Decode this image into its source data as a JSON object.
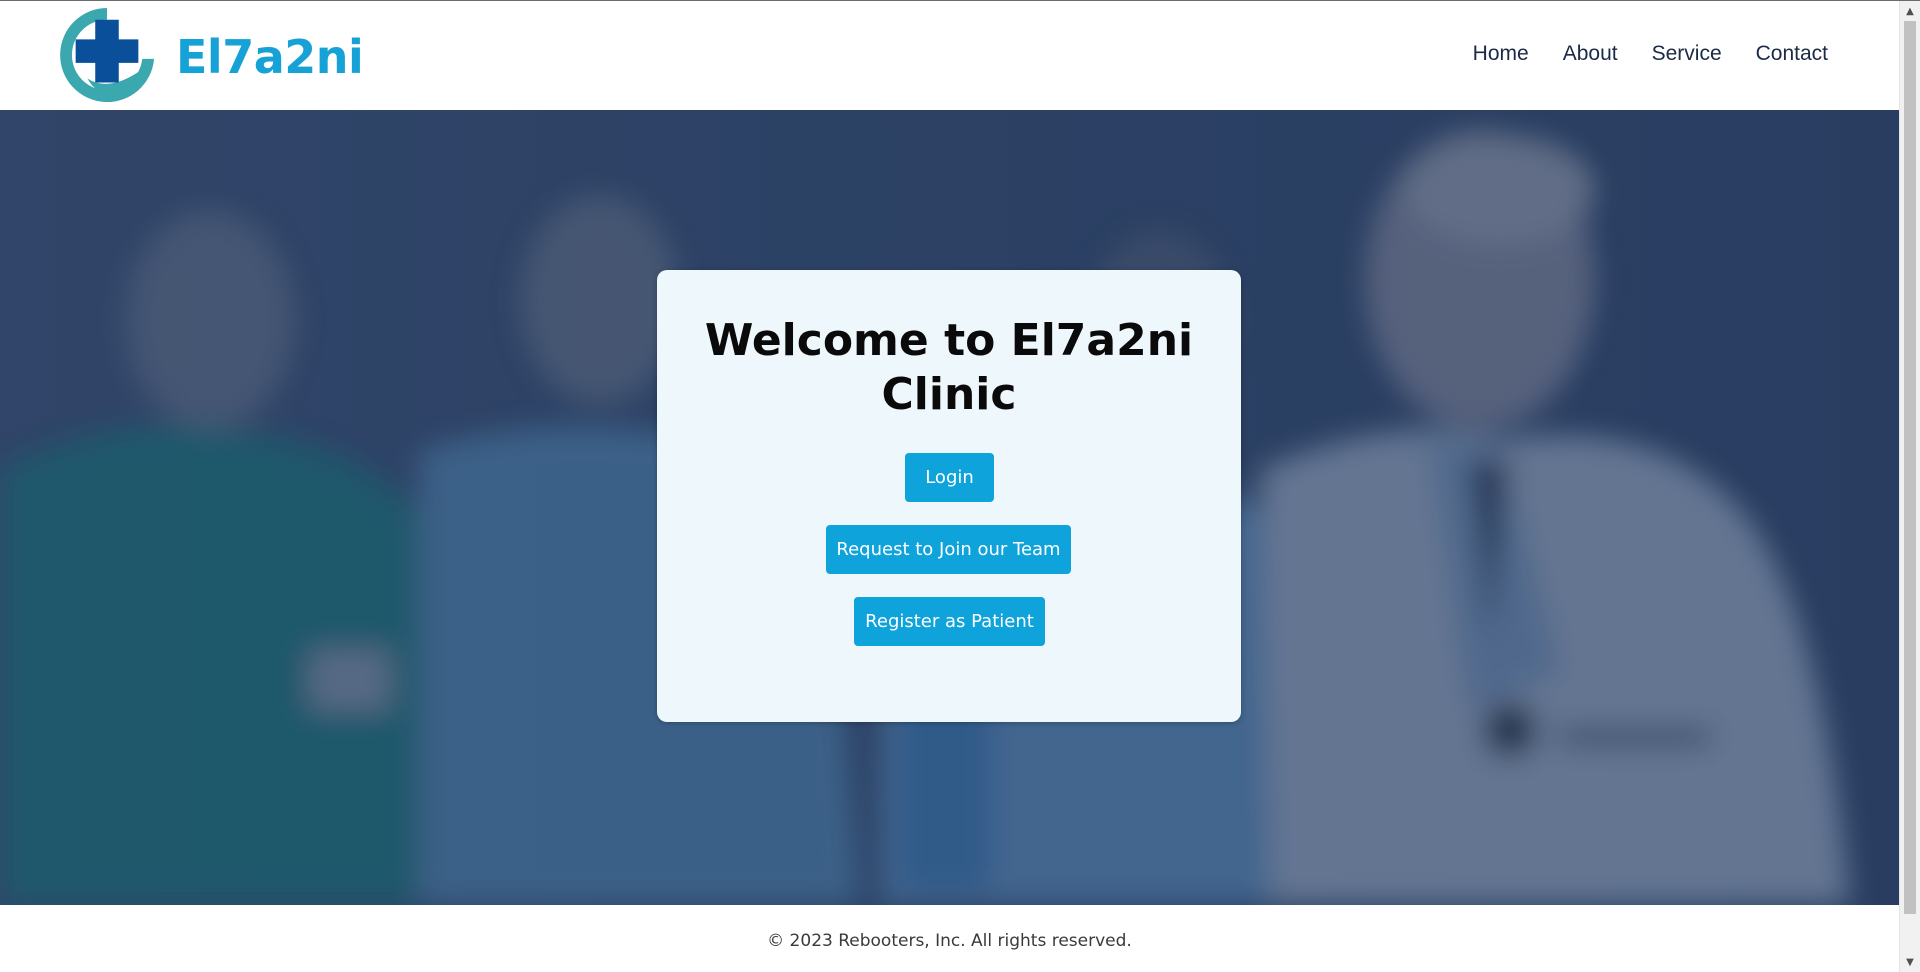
{
  "header": {
    "brand": "El7a2ni",
    "nav": {
      "home": "Home",
      "about": "About",
      "service": "Service",
      "contact": "Contact"
    }
  },
  "hero": {
    "title": "Welcome to El7a2ni Clinic",
    "buttons": {
      "login": "Login",
      "join": "Request to Join our Team",
      "register": "Register as Patient"
    }
  },
  "footer": {
    "copyright": "© 2023 Rebooters, Inc. All rights reserved."
  },
  "icons": {
    "logo": "medical-cross-hand-icon",
    "scroll_up": "chevron-up-icon",
    "scroll_down": "chevron-down-icon"
  },
  "colors": {
    "brand": "#16a2d6",
    "button": "#0ea3db",
    "hero_overlay": "#2f4466",
    "card": "#eef7fc",
    "nav_text": "#1c2a46"
  }
}
